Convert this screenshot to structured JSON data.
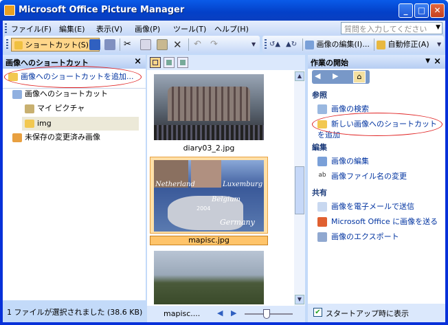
{
  "window": {
    "title": "Microsoft Office Picture Manager",
    "min_glyph": "_",
    "max_glyph": "□",
    "close_glyph": "✕"
  },
  "menubar": {
    "items": [
      "ファイル(F)",
      "編集(E)",
      "表示(V)",
      "画像(P)",
      "ツール(T)",
      "ヘルプ(H)"
    ],
    "ask_placeholder": "質問を入力してください"
  },
  "toolbar": {
    "shortcut_label": "ショートカット(S)...",
    "edit_picture_label": "画像の編集(I)...",
    "auto_correct_label": "自動修正(A)"
  },
  "left_pane": {
    "title": "画像へのショートカット",
    "close_glyph": "×",
    "add_shortcut": "画像へのショートカットを追加...",
    "tree": {
      "root": "画像へのショートカット",
      "children": [
        "マイ ピクチャ",
        "img"
      ],
      "unsaved": "未保存の変更済み画像"
    },
    "status": "1 ファイルが選択されました (38.6 KB)"
  },
  "center_pane": {
    "thumbnails": [
      {
        "caption": "diary03_2.jpg",
        "selected": false
      },
      {
        "caption": "mapisc.jpg",
        "selected": true
      },
      {
        "caption": "",
        "selected": false
      }
    ],
    "map_labels": [
      "Netherland",
      "Luxemburg",
      "Belgium",
      "2004",
      "Germany"
    ],
    "bottom_filename": "mapisc....",
    "zoom_level": 0.45
  },
  "task_pane": {
    "title": "作業の開始",
    "sections": [
      {
        "name": "参照",
        "links": [
          "画像の検索",
          "新しい画像へのショートカットを追加"
        ]
      },
      {
        "name": "編集",
        "links": [
          "画像の編集",
          "画像ファイル名の変更"
        ]
      },
      {
        "name": "共有",
        "links": [
          "画像を電子メールで送信",
          "Microsoft Office に画像を送る",
          "画像のエクスポート"
        ]
      }
    ],
    "startup_checkbox": "スタートアップ時に表示",
    "startup_checked": true
  },
  "colors": {
    "title_blue": "#0a5be9",
    "selection_orange": "#ffc46a",
    "annotation_red": "#e02020",
    "link_blue": "#0033a0"
  }
}
